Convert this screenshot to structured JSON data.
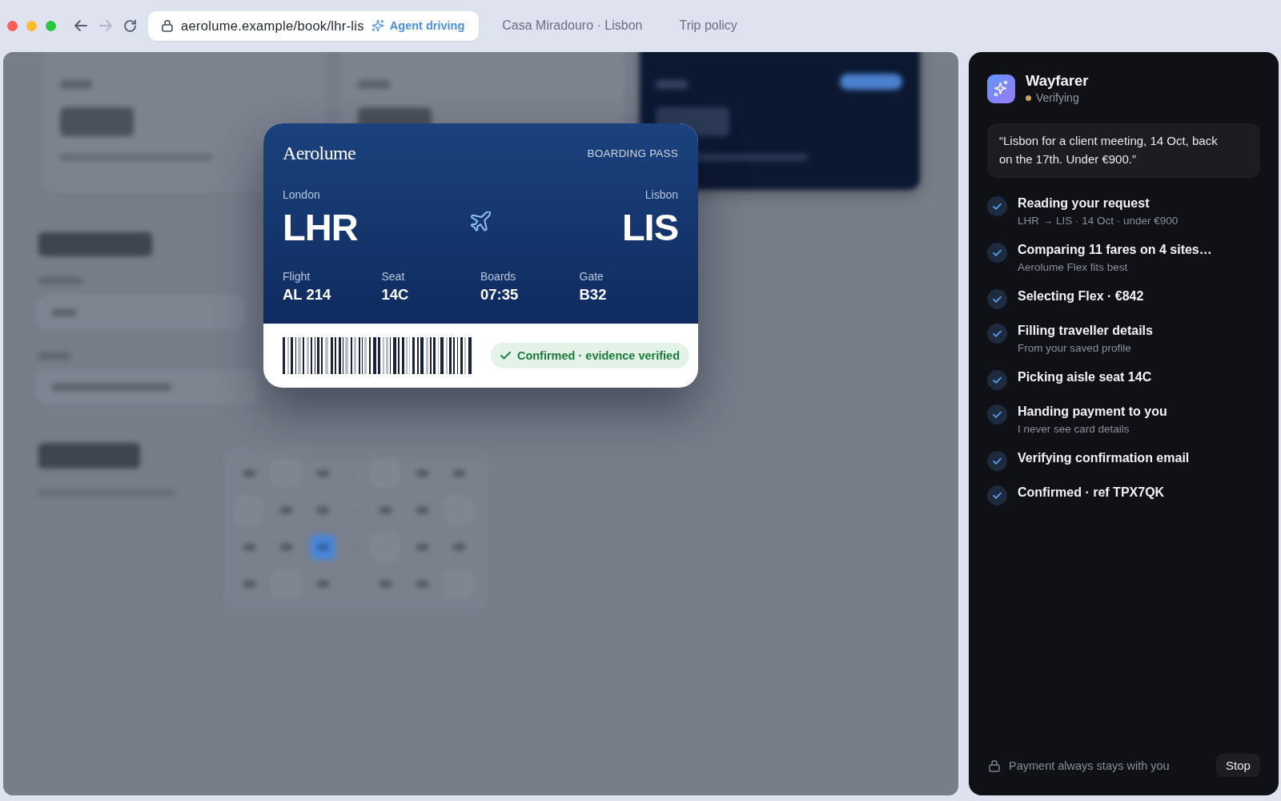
{
  "browser": {
    "nav": [
      {
        "kind": "back",
        "disabled": false
      },
      {
        "kind": "forward",
        "disabled": true
      },
      {
        "kind": "reload",
        "disabled": false
      }
    ],
    "address": "aerolume.example/book/lhr-lis",
    "agent_badge": "Agent driving",
    "tabs": [
      {
        "label": "Casa Miradouro · Lisbon",
        "selected": false
      },
      {
        "label": "Trip policy",
        "selected": false
      }
    ]
  },
  "boarding_pass": {
    "airline": "Aerolume",
    "title": "BOARDING PASS",
    "origin": {
      "city": "London",
      "code": "LHR"
    },
    "destination": {
      "city": "Lisbon",
      "code": "LIS"
    },
    "details": [
      {
        "label": "Flight",
        "value": "AL 214"
      },
      {
        "label": "Seat",
        "value": "14C"
      },
      {
        "label": "Boards",
        "value": "07:35"
      },
      {
        "label": "Gate",
        "value": "B32"
      }
    ],
    "status": "Confirmed · evidence verified"
  },
  "assistant": {
    "name": "Wayfarer",
    "status": "Verifying",
    "request": "“Lisbon for a client meeting, 14 Oct, back on the 17th. Under €900.”",
    "steps": [
      {
        "title": "Reading your request",
        "detail": "LHR → LIS · 14 Oct · under €900",
        "done": true
      },
      {
        "title": "Comparing 11 fares on 4 sites…",
        "detail": "Aerolume Flex fits best",
        "done": true
      },
      {
        "title": "Selecting Flex · €842",
        "done": true
      },
      {
        "title": "Filling traveller details",
        "detail": "From your saved profile",
        "done": true
      },
      {
        "title": "Picking aisle seat 14C",
        "done": true
      },
      {
        "title": "Handing payment to you",
        "detail": "I never see card details",
        "done": true
      },
      {
        "title": "Verifying confirmation email",
        "done": true
      },
      {
        "title": "Confirmed · ref TPX7QK",
        "done": true
      }
    ],
    "footer_note": "Payment always stays with you",
    "stop_button": "Stop"
  }
}
